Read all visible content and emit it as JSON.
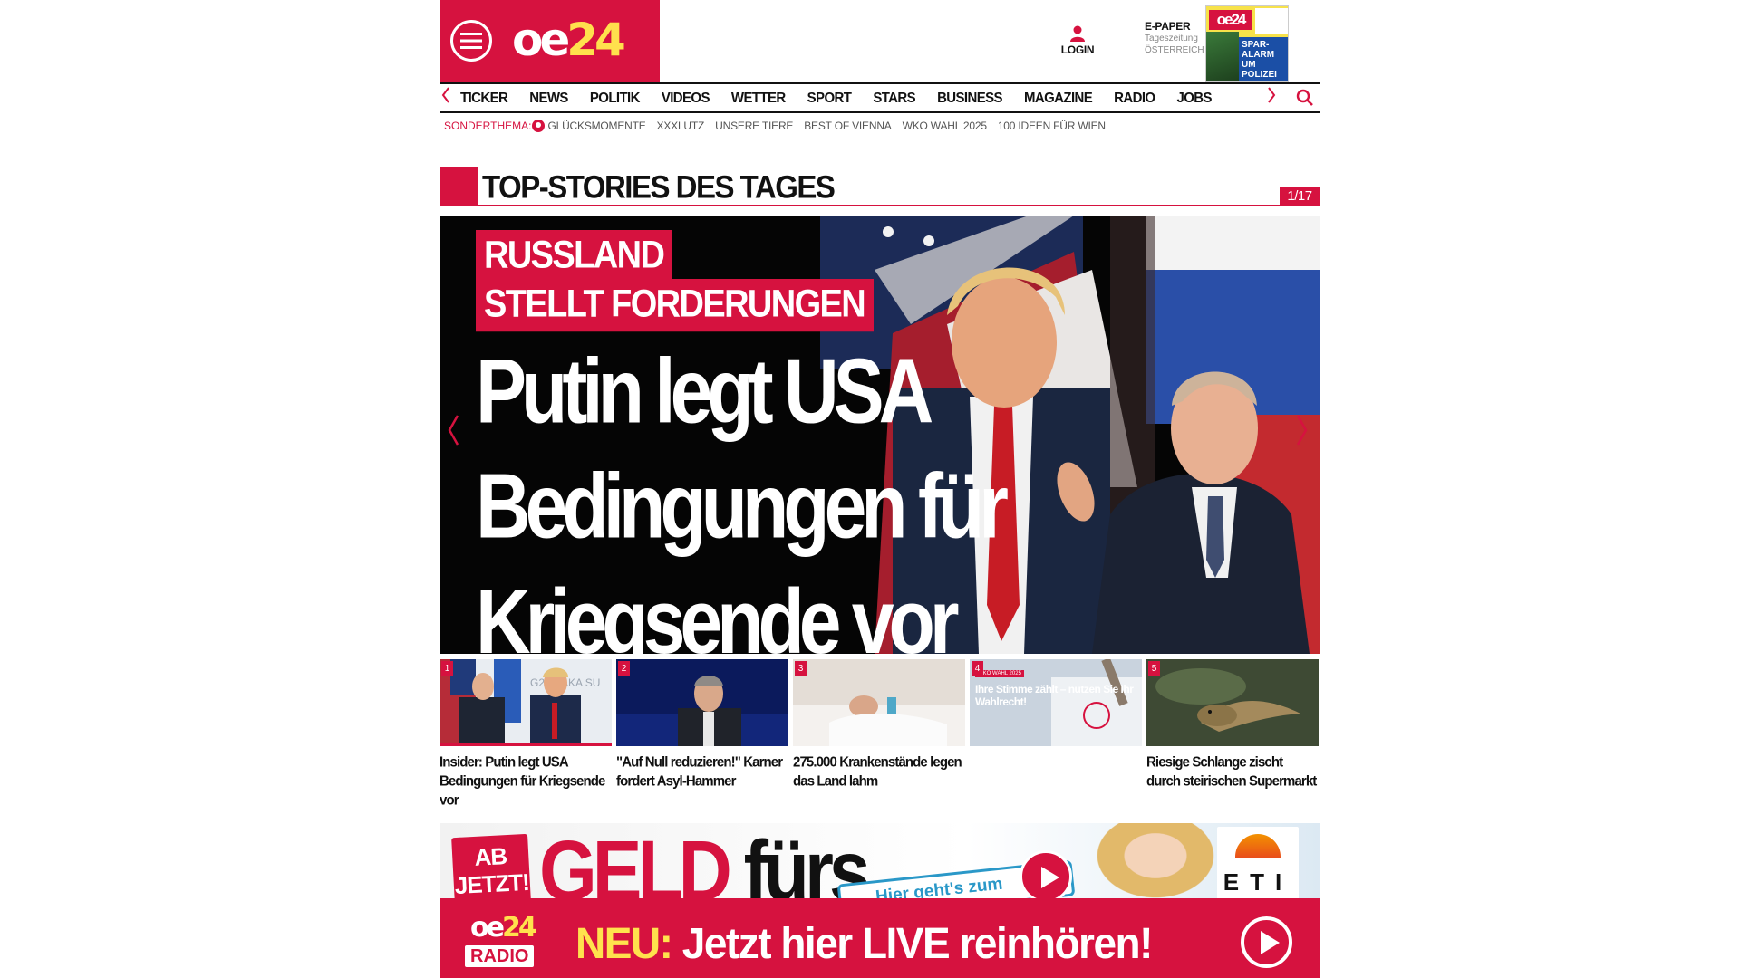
{
  "header": {
    "logo_main": "oe",
    "logo_num": "24",
    "login_label": "LOGIN",
    "epaper": {
      "title": "E-PAPER",
      "subtitle_1": "Tageszeitung",
      "subtitle_2": "ÖSTERREICH",
      "cover_logo": "oe24",
      "cover_headline": "SPAR-ALARM UM POLIZEI"
    }
  },
  "nav": {
    "items": [
      "TICKER",
      "NEWS",
      "POLITIK",
      "VIDEOS",
      "WETTER",
      "SPORT",
      "STARS",
      "BUSINESS",
      "MAGAZINE",
      "RADIO",
      "JOBS"
    ]
  },
  "sub_nav": {
    "lead": "SONDERTHEMA:",
    "items": [
      "GLÜCKSMOMENTE",
      "XXXLUTZ",
      "UNSERE TIERE",
      "BEST OF VIENNA",
      "WKO WAHL 2025",
      "100 IDEEN FÜR WIEN"
    ]
  },
  "section": {
    "title": "TOP-STORIES DES TAGES",
    "counter": "1/17"
  },
  "hero": {
    "kicker_1": "RUSSLAND",
    "kicker_2": "STELLT FORDERUNGEN",
    "headline": "Putin legt USA Bedingungen für Kriegsende vor"
  },
  "teasers": [
    {
      "num": "1",
      "title": "Insider: Putin legt USA Bedingungen für Kriegsende vor"
    },
    {
      "num": "2",
      "title": "\"Auf Null reduzieren!\" Karner fordert Asyl-Hammer"
    },
    {
      "num": "3",
      "title": "275.000 Krankenstände legen das Land lahm"
    },
    {
      "num": "4",
      "title": "",
      "ad_tag": "WKO WAHL 2025",
      "ad_text": "Ihre Stimme zählt – nutzen Sie Ihr Wahlrecht!"
    },
    {
      "num": "5",
      "title": "Riesige Schlange zischt durch steirischen Supermarkt"
    }
  ],
  "banner": {
    "ab_jetzt": "AB JETZT!",
    "geld": "GELD",
    "geld_rest": " fürs",
    "hier": "Hier geht's zum",
    "eti": "ETI"
  },
  "radio": {
    "logo_main": "oe",
    "logo_num": "24",
    "logo_tag": "RADIO",
    "neu": "NEU:",
    "text": " Jetzt hier LIVE reinhören!"
  },
  "colors": {
    "brand_red": "#d6123f",
    "logo_yellow": "#ffe14d"
  },
  "icons": [
    "menu-icon",
    "user-icon",
    "search-icon",
    "chevron-left-icon",
    "chevron-right-icon",
    "play-icon"
  ]
}
